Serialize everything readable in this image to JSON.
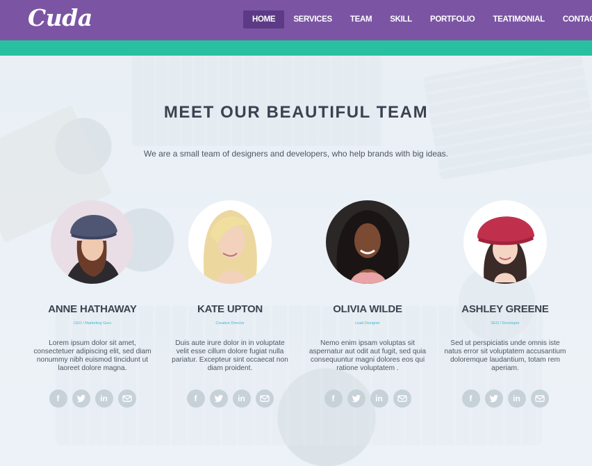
{
  "brand": {
    "name": "Cuda"
  },
  "nav": {
    "items": [
      {
        "label": "HOME",
        "active": true
      },
      {
        "label": "SERVICES",
        "active": false
      },
      {
        "label": "TEAM",
        "active": false
      },
      {
        "label": "SKILL",
        "active": false
      },
      {
        "label": "PORTFOLIO",
        "active": false
      },
      {
        "label": "TEATIMONIAL",
        "active": false
      },
      {
        "label": "CONTACT",
        "active": false
      }
    ]
  },
  "team": {
    "title": "MEET OUR BEAUTIFUL TEAM",
    "subtitle": "We are a small team of designers and developers, who help brands with big ideas.",
    "members": [
      {
        "name": "ANNE HATHAWAY",
        "role": "CEO / Marketing Guru",
        "bio": "Lorem ipsum dolor sit amet, consectetuer adipiscing elit, sed diam nonummy nibh euismod tincidunt ut laoreet dolore magna."
      },
      {
        "name": "KATE UPTON",
        "role": "Creative Director",
        "bio": "Duis aute irure dolor in in voluptate velit esse cillum dolore fugiat nulla pariatur. Excepteur sint occaecat non diam proident."
      },
      {
        "name": "OLIVIA WILDE",
        "role": "Lead Designer",
        "bio": "Nemo enim ipsam voluptas sit aspernatur aut odit aut fugit, sed quia consequuntur magni dolores eos qui ratione voluptatem ."
      },
      {
        "name": "ASHLEY GREENE",
        "role": "SEO / Developer",
        "bio": "Sed ut perspiciatis unde omnis iste natus error sit voluptatem accusantium doloremque laudantium, totam rem aperiam."
      }
    ],
    "social_icons": [
      "facebook-icon",
      "twitter-icon",
      "linkedin-icon",
      "mail-icon"
    ],
    "social_glyphs": {
      "facebook": "f",
      "linkedin": "in"
    }
  },
  "colors": {
    "header": "#7b55a3",
    "nav_active": "#5c3a86",
    "teal_strip": "#28c0a0",
    "role_text": "#43b8d6"
  }
}
